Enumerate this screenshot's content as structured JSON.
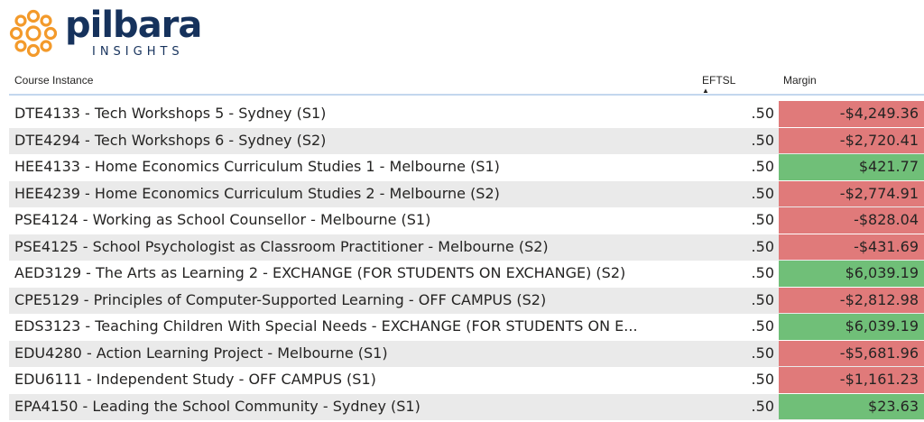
{
  "logo": {
    "word": "pilbara",
    "sub": "INSIGHTS"
  },
  "table": {
    "headers": {
      "course": "Course Instance",
      "eftsl": "EFTSL",
      "sort_indicator": "▲",
      "margin": "Margin"
    },
    "rows": [
      {
        "course": "DTE4133 - Tech Workshops 5 - Sydney (S1)",
        "eftsl": ".50",
        "margin": "-$4,249.36",
        "sign": "neg"
      },
      {
        "course": "DTE4294 - Tech Workshops 6 - Sydney (S2)",
        "eftsl": ".50",
        "margin": "-$2,720.41",
        "sign": "neg"
      },
      {
        "course": "HEE4133 - Home Economics Curriculum Studies 1 - Melbourne (S1)",
        "eftsl": ".50",
        "margin": "$421.77",
        "sign": "pos"
      },
      {
        "course": "HEE4239 - Home Economics Curriculum Studies 2 - Melbourne (S2)",
        "eftsl": ".50",
        "margin": "-$2,774.91",
        "sign": "neg"
      },
      {
        "course": "PSE4124 - Working as School Counsellor - Melbourne (S1)",
        "eftsl": ".50",
        "margin": "-$828.04",
        "sign": "neg"
      },
      {
        "course": "PSE4125 - School Psychologist as Classroom Practitioner - Melbourne (S2)",
        "eftsl": ".50",
        "margin": "-$431.69",
        "sign": "neg"
      },
      {
        "course": "AED3129 - The Arts as Learning 2 - EXCHANGE (FOR STUDENTS ON EXCHANGE) (S2)",
        "eftsl": ".50",
        "margin": "$6,039.19",
        "sign": "pos"
      },
      {
        "course": "CPE5129 - Principles of Computer-Supported Learning - OFF CAMPUS (S2)",
        "eftsl": ".50",
        "margin": "-$2,812.98",
        "sign": "neg"
      },
      {
        "course": "EDS3123 - Teaching Children With Special Needs - EXCHANGE (FOR STUDENTS ON E...",
        "eftsl": ".50",
        "margin": "$6,039.19",
        "sign": "pos"
      },
      {
        "course": "EDU4280 - Action Learning Project - Melbourne (S1)",
        "eftsl": ".50",
        "margin": "-$5,681.96",
        "sign": "neg"
      },
      {
        "course": "EDU6111 - Independent Study - OFF CAMPUS (S1)",
        "eftsl": ".50",
        "margin": "-$1,161.23",
        "sign": "neg"
      },
      {
        "course": "EPA4150 - Leading the School Community - Sydney (S1)",
        "eftsl": ".50",
        "margin": "$23.63",
        "sign": "pos"
      }
    ]
  },
  "colors": {
    "negative": "#e07a7a",
    "positive": "#70bf78",
    "brand_orange": "#f39a2b",
    "brand_navy": "#16325c"
  }
}
